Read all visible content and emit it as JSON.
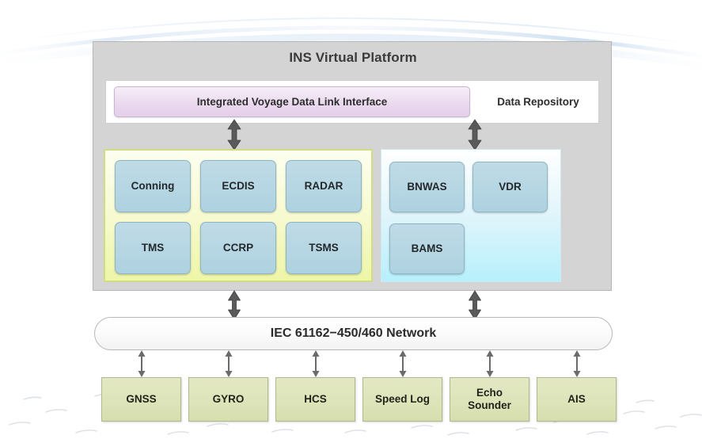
{
  "diagram": {
    "title_visible": false,
    "platform": {
      "label": "INS Virtual Platform",
      "repository": {
        "interface_label": "Integrated Voyage Data Link Interface",
        "repository_label": "Data Repository"
      },
      "navigation_group": {
        "tiles": [
          {
            "label": "Conning"
          },
          {
            "label": "ECDIS"
          },
          {
            "label": "RADAR"
          },
          {
            "label": "TMS"
          },
          {
            "label": "CCRP"
          },
          {
            "label": "TSMS"
          }
        ]
      },
      "auxiliary_group": {
        "tiles": [
          {
            "label": "BNWAS"
          },
          {
            "label": "VDR"
          },
          {
            "label": "BAMS"
          }
        ]
      }
    },
    "network": {
      "label": "IEC 61162−450/460 Network"
    },
    "sensors": [
      {
        "label": "GNSS"
      },
      {
        "label": "GYRO"
      },
      {
        "label": "HCS"
      },
      {
        "label": "Speed Log"
      },
      {
        "label": "Echo\nSounder"
      },
      {
        "label": "AIS"
      }
    ],
    "connectors": {
      "upper_arrows": 2,
      "lower_arrows": 2,
      "sensor_arrows": 6,
      "style": "double-headed"
    },
    "colors": {
      "platform_bg": "#d4d4d4",
      "interface_box": "#ead9ee",
      "nav_group_border": "#d2dc82",
      "nav_group_bg": "#f6facc",
      "aux_group_bg": "#ddf4fb",
      "tile_fill": "#b6d6e3",
      "sensor_fill": "#dde4b9",
      "network_fill": "#fcfcfc",
      "arrow_fill": "#555555",
      "text_dark": "#2d2d2d",
      "background": "#ffffff",
      "decor_arc": "#c5dbef"
    }
  }
}
